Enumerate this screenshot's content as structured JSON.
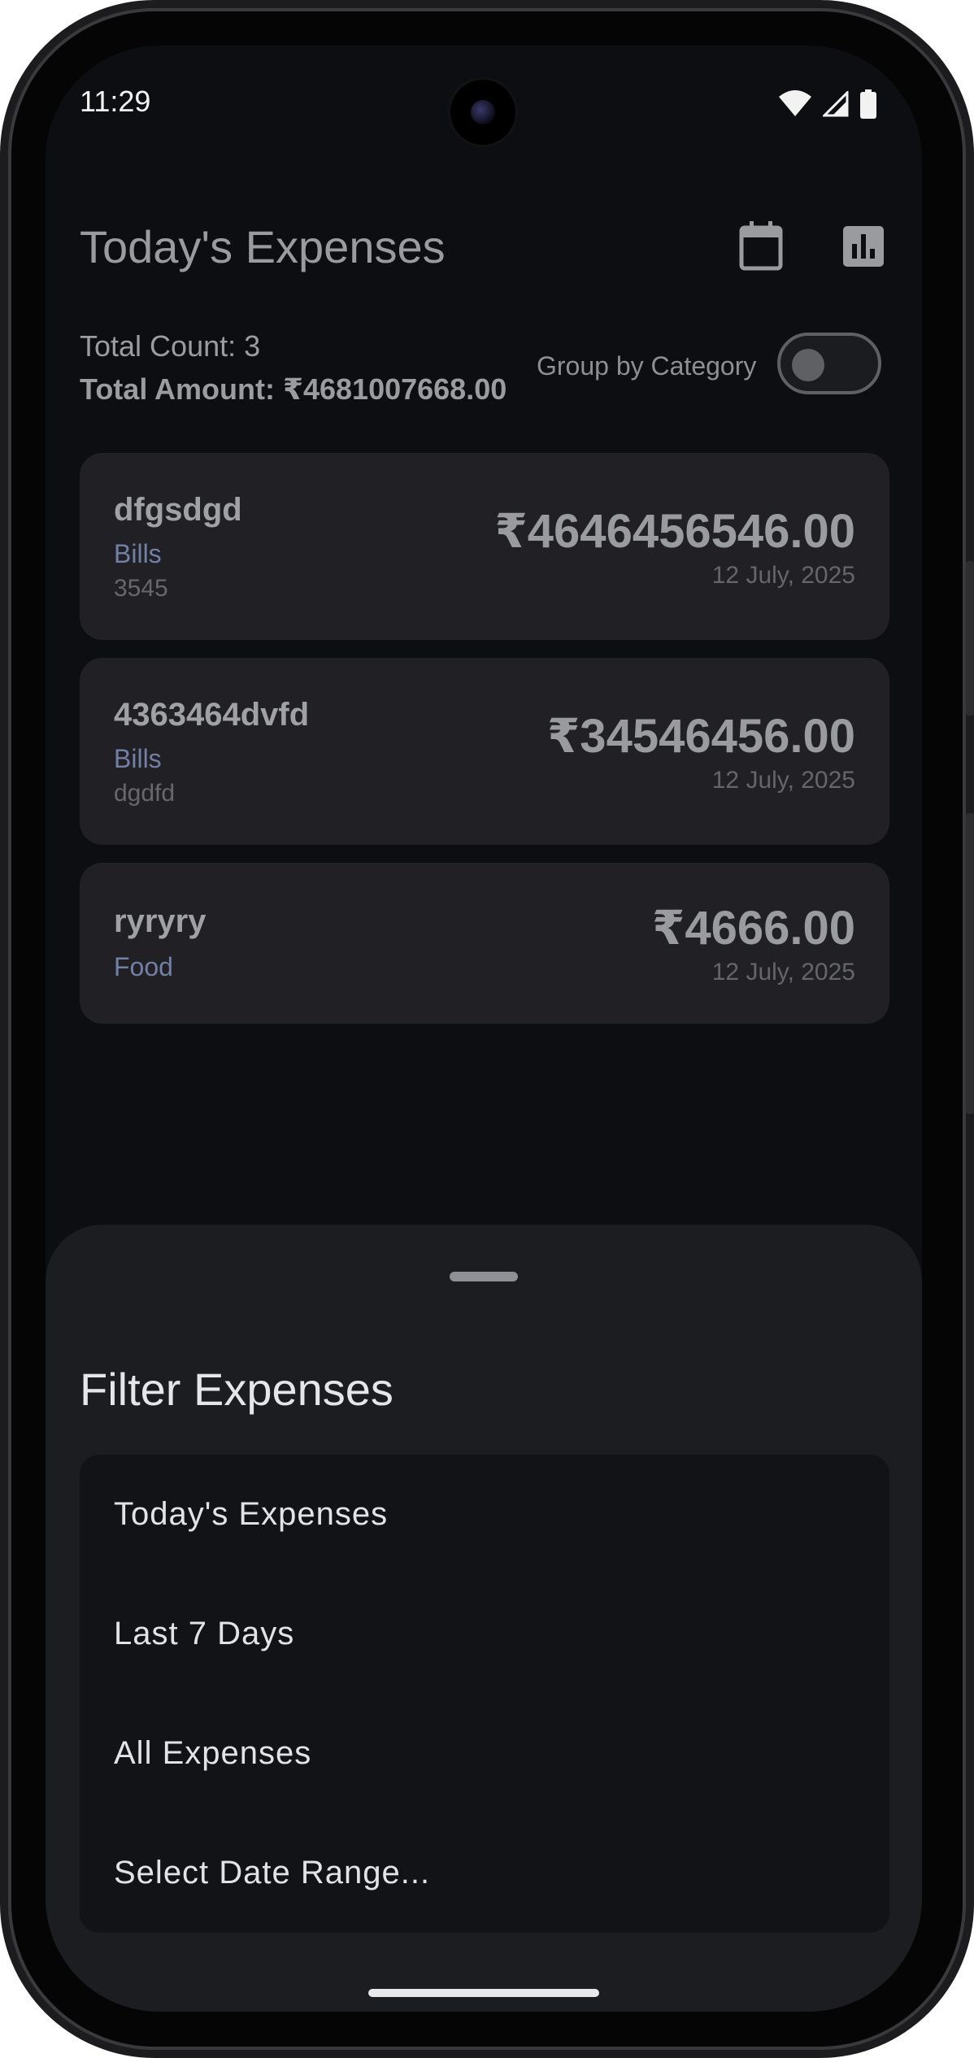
{
  "status_bar": {
    "time": "11:29",
    "icons": [
      "wifi-icon",
      "cell-signal-icon",
      "battery-icon"
    ]
  },
  "app_bar": {
    "title": "Today's Expenses",
    "actions": [
      "calendar-icon",
      "bar-chart-icon"
    ]
  },
  "summary": {
    "total_count": "Total Count: 3",
    "total_amount": "Total Amount: ₹4681007668.00",
    "group_label": "Group by Category",
    "group_enabled": false
  },
  "expenses": [
    {
      "title": "dfgsdgd",
      "category": "Bills",
      "note": "3545",
      "amount": "₹4646456546.00",
      "date": "12 July, 2025"
    },
    {
      "title": "4363464dvfd",
      "category": "Bills",
      "note": "dgdfd",
      "amount": "₹34546456.00",
      "date": "12 July, 2025"
    },
    {
      "title": "ryryry",
      "category": "Food",
      "note": "",
      "amount": "₹4666.00",
      "date": "12 July, 2025"
    }
  ],
  "sheet": {
    "title": "Filter Expenses",
    "options": [
      "Today's Expenses",
      "Last 7 Days",
      "All Expenses",
      "Select Date Range..."
    ]
  },
  "colors": {
    "background": "#0d0e11",
    "card": "#212125",
    "category": "#7380a6",
    "sheet": "#1c1d21"
  }
}
